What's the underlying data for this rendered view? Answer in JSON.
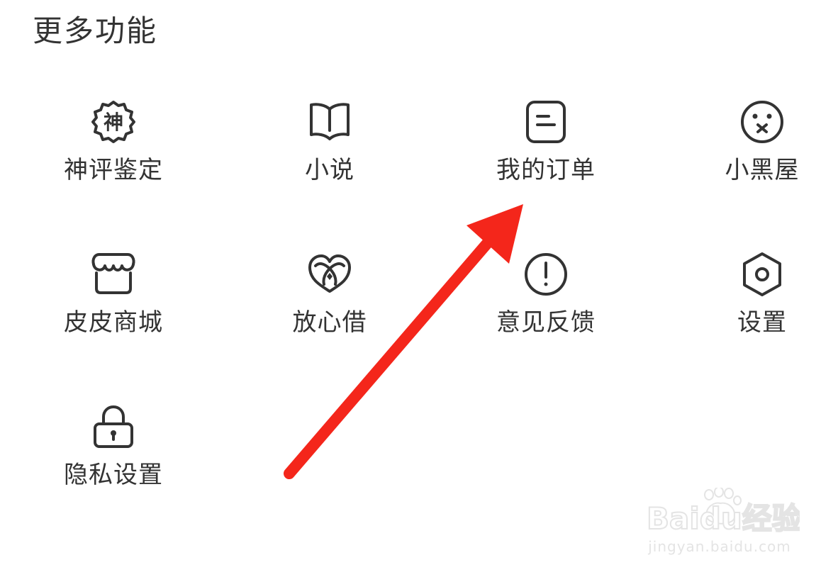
{
  "section": {
    "title": "更多功能"
  },
  "features": [
    {
      "label": "神评鉴定",
      "icon": "shen-badge-icon",
      "badge_char": "神"
    },
    {
      "label": "小说",
      "icon": "open-book-icon"
    },
    {
      "label": "我的订单",
      "icon": "order-document-icon"
    },
    {
      "label": "小黑屋",
      "icon": "dizzy-face-icon"
    },
    {
      "label": "皮皮商城",
      "icon": "shop-store-icon"
    },
    {
      "label": "放心借",
      "icon": "heart-coin-icon"
    },
    {
      "label": "意见反馈",
      "icon": "exclamation-circle-icon"
    },
    {
      "label": "设置",
      "icon": "hexagon-gear-icon"
    },
    {
      "label": "隐私设置",
      "icon": "lock-icon"
    }
  ],
  "watermark": {
    "logo_text": "Baidu经验",
    "url": "jingyan.baidu.com"
  },
  "colors": {
    "text": "#333333",
    "icon_stroke": "#333333",
    "annotation_arrow": "#f4261b",
    "watermark": "#e4e4e4"
  }
}
